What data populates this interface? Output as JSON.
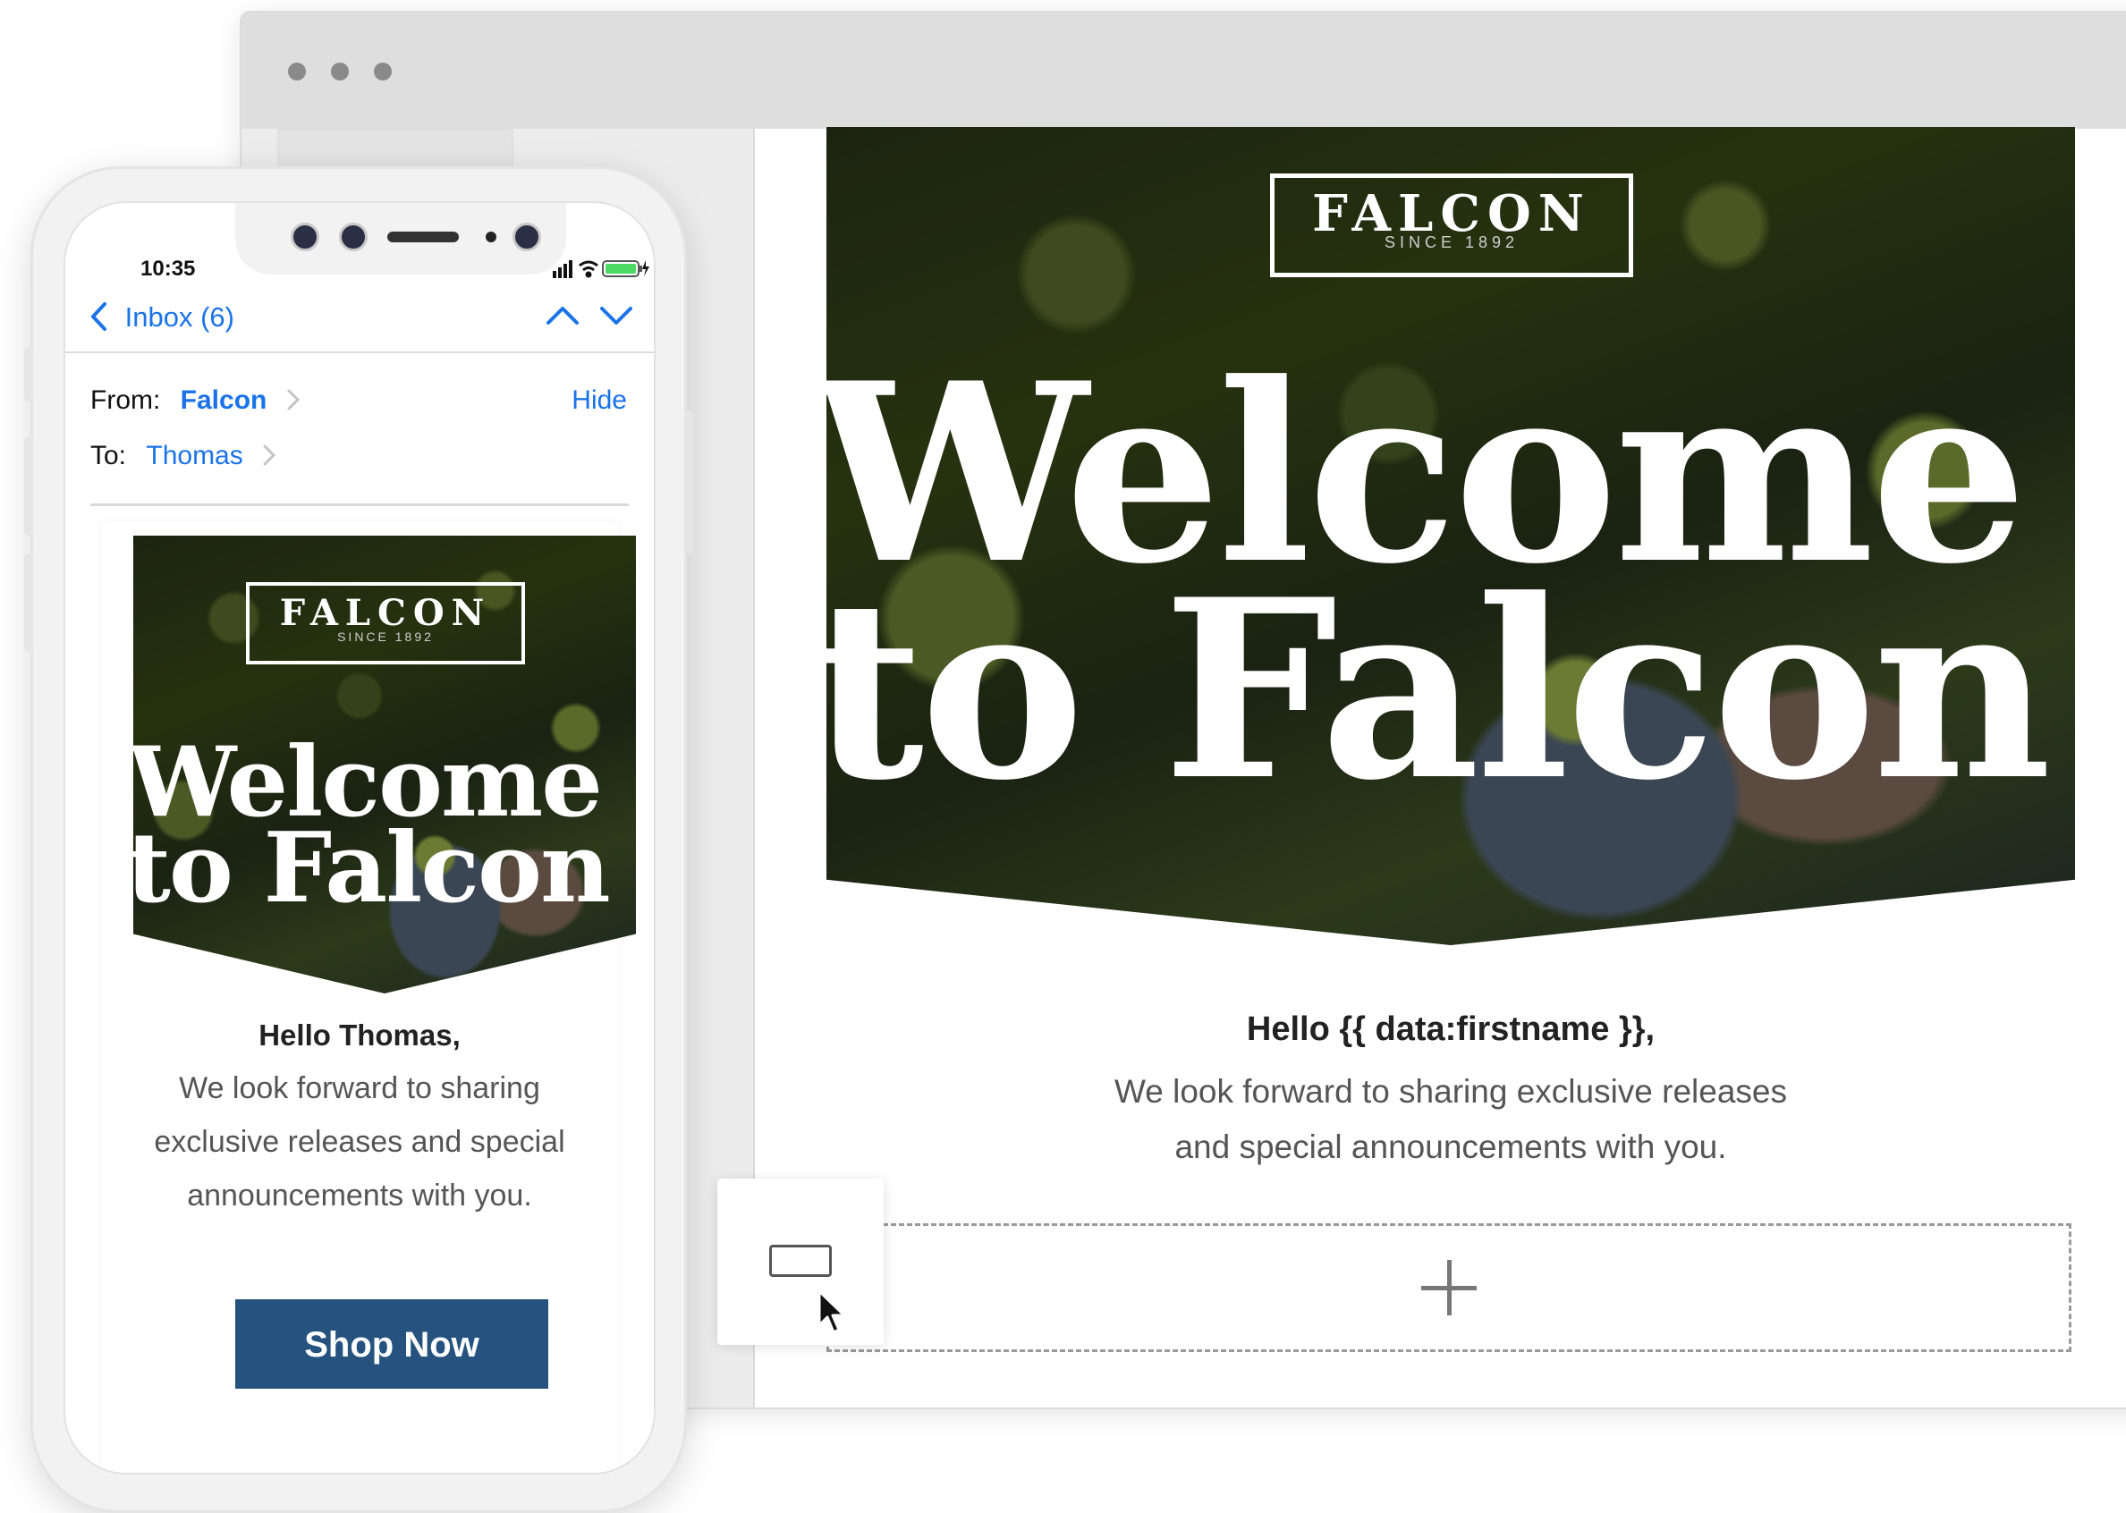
{
  "brand": {
    "logo_text": "FALCON",
    "logo_since": "SINCE 1892",
    "headline_line1": "Welcome",
    "headline_line2": "to Falcon"
  },
  "desktop": {
    "greeting": "Hello {{ data:firstname }},",
    "body_line1": "We look forward to sharing exclusive releases",
    "body_line2": "and special announcements with you."
  },
  "phone": {
    "time": "10:35",
    "nav": {
      "back_label": "Inbox (6)"
    },
    "from_label": "From:",
    "from_value": "Falcon",
    "to_label": "To:",
    "to_value": "Thomas",
    "hide_label": "Hide",
    "greeting": "Hello Thomas,",
    "body_line1": "We look forward to sharing",
    "body_line2": "exclusive releases and special",
    "body_line3": "announcements with you.",
    "cta_label": "Shop Now"
  },
  "colors": {
    "link_blue": "#1a73e8",
    "cta_blue": "#25527f",
    "battery_green": "#4cd964"
  }
}
